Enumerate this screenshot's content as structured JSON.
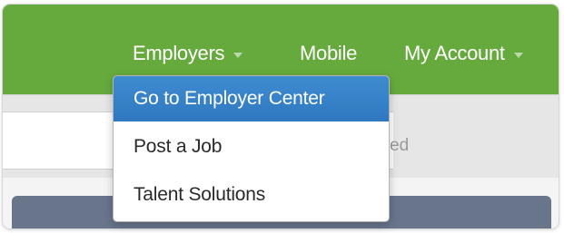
{
  "navbar": {
    "items": [
      {
        "label": "Employers",
        "has_caret": true
      },
      {
        "label": "Mobile",
        "has_caret": false
      },
      {
        "label": "My Account",
        "has_caret": true
      }
    ]
  },
  "subbar": {
    "advanced_partial": "nced"
  },
  "dropdown": {
    "items": [
      {
        "label": "Go to Employer Center",
        "highlighted": true
      },
      {
        "label": "Post a Job",
        "highlighted": false
      },
      {
        "label": "Talent Solutions",
        "highlighted": false
      }
    ]
  },
  "colors": {
    "navbar_green": "#66aa3e",
    "highlight_blue": "#3a84c9",
    "panel_slate": "#68758b"
  }
}
